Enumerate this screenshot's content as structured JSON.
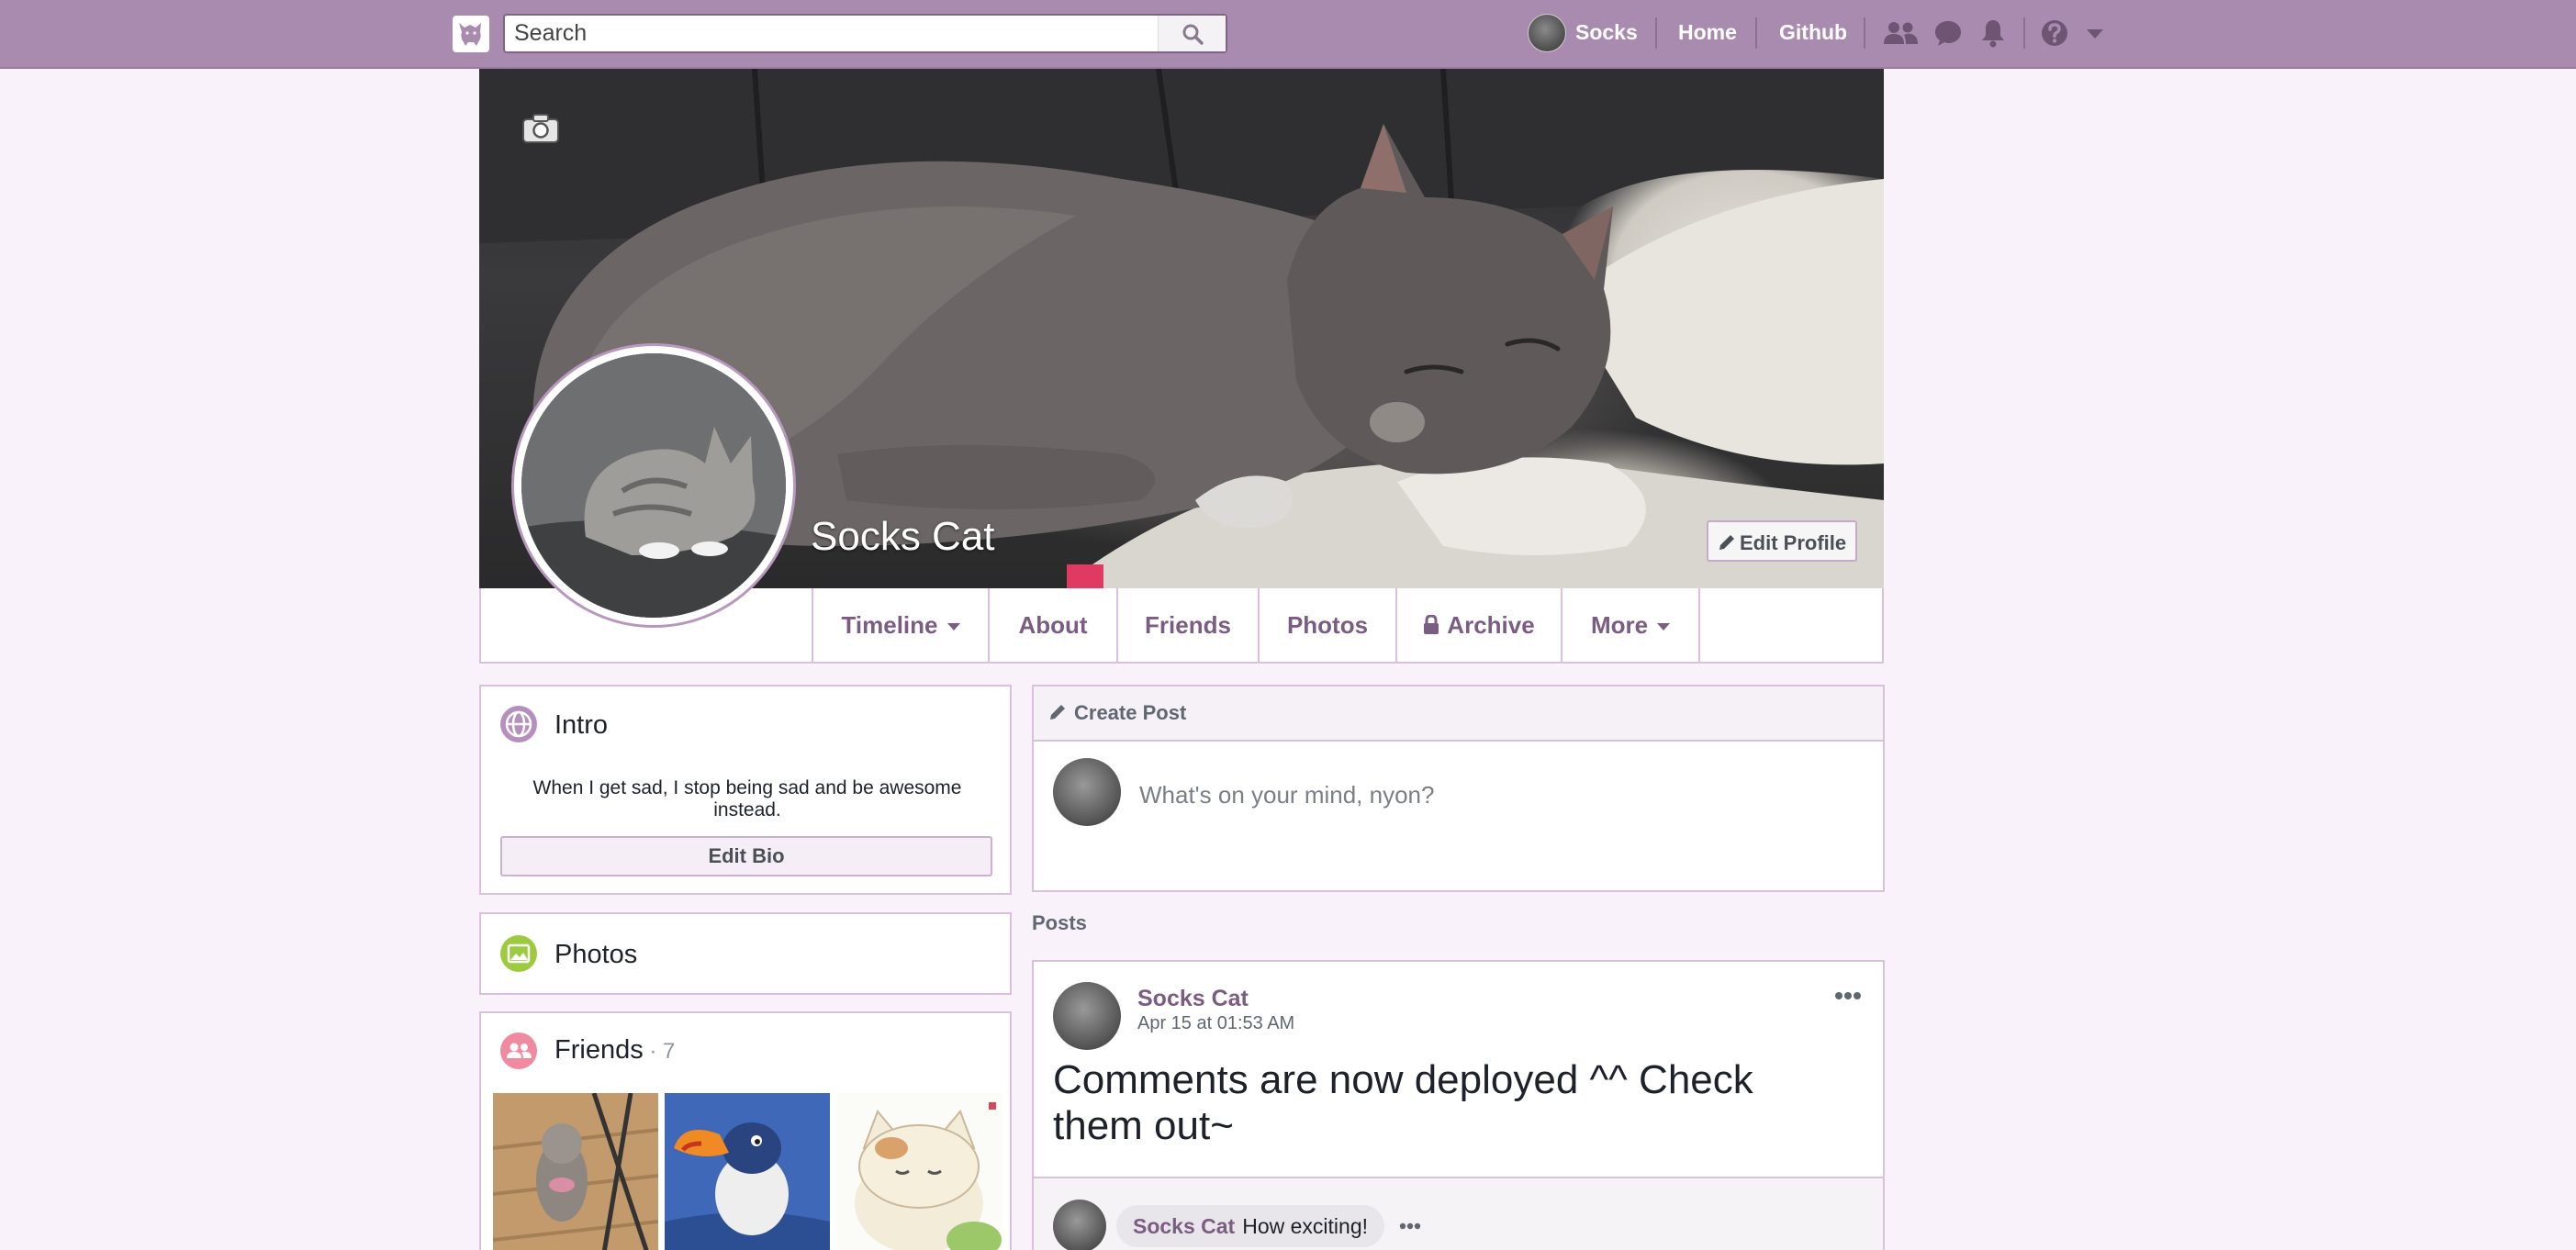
{
  "topbar": {
    "search_placeholder": "Search",
    "user_name": "Socks",
    "home": "Home",
    "github": "Github"
  },
  "profile": {
    "name": "Socks Cat",
    "edit_profile": "Edit Profile"
  },
  "tabs": [
    {
      "label": "Timeline",
      "dropdown": true
    },
    {
      "label": "About"
    },
    {
      "label": "Friends"
    },
    {
      "label": "Photos"
    },
    {
      "label": "Archive",
      "icon": "lock-icon"
    },
    {
      "label": "More",
      "dropdown": true
    }
  ],
  "intro": {
    "title": "Intro",
    "bio": "When I get sad, I stop being sad and be awesome instead.",
    "edit_bio": "Edit Bio"
  },
  "photos": {
    "title": "Photos"
  },
  "friends": {
    "title": "Friends",
    "count": " · 7"
  },
  "create_post": {
    "header": "Create Post",
    "placeholder": "What's on your mind, nyon?"
  },
  "posts": {
    "label": "Posts",
    "items": [
      {
        "author": "Socks Cat",
        "time": "Apr 15 at 01:53 AM",
        "body": "Comments are now deployed ^^ Check them out~",
        "comments": [
          {
            "author": "Socks Cat",
            "text": "How exciting!"
          }
        ]
      }
    ]
  },
  "colors": {
    "topbar": "#a98bb0",
    "accent": "#7b5c82",
    "page_bg": "#faf2fa",
    "border": "#d9c1dd"
  }
}
